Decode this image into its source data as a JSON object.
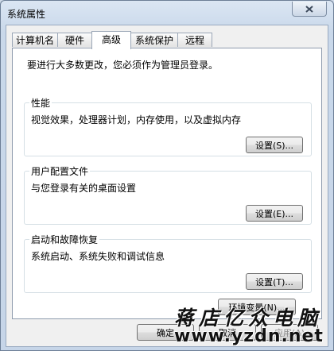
{
  "window": {
    "title": "系统属性"
  },
  "tabs": [
    {
      "label": "计算机名",
      "active": false
    },
    {
      "label": "硬件",
      "active": false
    },
    {
      "label": "高级",
      "active": true
    },
    {
      "label": "系统保护",
      "active": false
    },
    {
      "label": "远程",
      "active": false
    }
  ],
  "panel": {
    "intro": "要进行大多数更改，您必须作为管理员登录。",
    "performance": {
      "legend": "性能",
      "description": "视觉效果，处理器计划，内存使用，以及虚拟内存",
      "button": "设置(S)..."
    },
    "user_profiles": {
      "legend": "用户配置文件",
      "description": "与您登录有关的桌面设置",
      "button": "设置(E)..."
    },
    "startup_recovery": {
      "legend": "启动和故障恢复",
      "description": "系统启动、系统失败和调试信息",
      "button": "设置(T)..."
    },
    "env_button": "环境变量(N)..."
  },
  "footer": {
    "ok": "确定",
    "cancel": "取消",
    "apply": "应用(A)"
  },
  "watermark": {
    "line1": "蒋店亿众电脑",
    "line2": "www.yzdn.net"
  },
  "icons": {
    "close": "close-icon"
  }
}
